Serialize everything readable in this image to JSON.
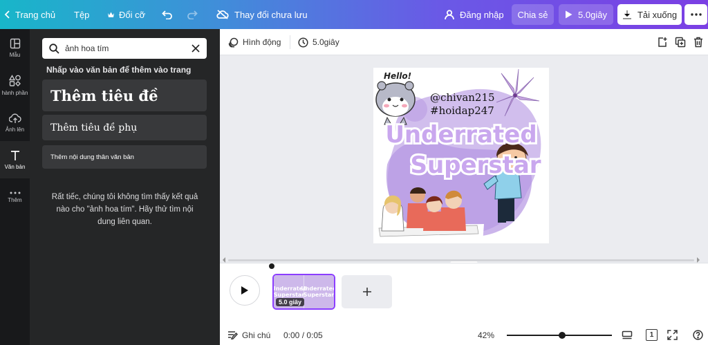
{
  "topbar": {
    "home_label": "Trang chủ",
    "file_label": "Tệp",
    "resize_label": "Đổi cỡ",
    "save_status": "Thay đổi chưa lưu",
    "login_label": "Đăng nhập",
    "share_label": "Chia sẻ",
    "duration_label": "5.0giây",
    "download_label": "Tải xuống"
  },
  "rail": {
    "items": [
      {
        "label": "Mẫu",
        "icon": "templates-icon"
      },
      {
        "label": "hành phần",
        "icon": "elements-icon"
      },
      {
        "label": "Ảnh lên",
        "icon": "upload-icon"
      },
      {
        "label": "Văn bản",
        "icon": "text-icon"
      },
      {
        "label": "Thêm",
        "icon": "more-icon"
      }
    ]
  },
  "panel": {
    "search_value": "ảnh hoa tím",
    "hint": "Nhấp vào văn bản để thêm vào trang",
    "add_heading": "Thêm tiêu đề",
    "add_subheading": "Thêm tiêu đề phụ",
    "add_body": "Thêm nội dung thân văn bản",
    "empty_message": "Rất tiếc, chúng tôi không tìm thấy kết quả nào cho \"ảnh hoa tím\". Hãy thử tìm nội dung liên quan."
  },
  "toolbar": {
    "animate_label": "Hình động",
    "duration_label": "5.0giây"
  },
  "design": {
    "hello_text": "Hello!",
    "handle1": "@chivan215",
    "handle2": "#hoidap247",
    "title_line1": "Underrated",
    "title_line2": "Superstar"
  },
  "timeline": {
    "thumb_duration": "5.0 giây"
  },
  "footer": {
    "notes_label": "Ghi chú",
    "time": "0:00 / 0:05",
    "zoom": "42%",
    "zoom_level": 0.42,
    "page_count": "1"
  },
  "colors": {
    "accent": "#8b3dff",
    "panel_bg": "#252627",
    "rail_bg": "#18191b"
  }
}
